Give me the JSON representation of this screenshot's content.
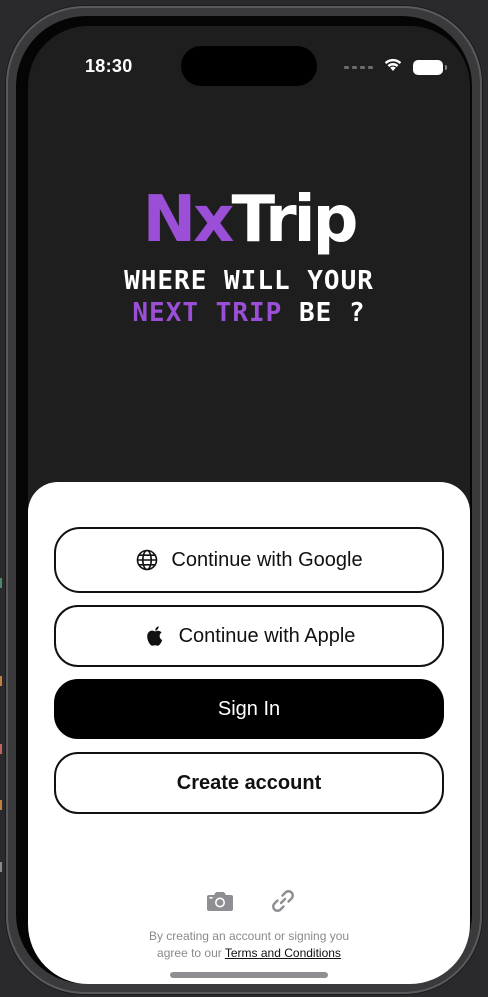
{
  "status_bar": {
    "time": "18:30"
  },
  "brand": {
    "logo_part1": "Nx",
    "logo_part2": "Trip"
  },
  "tagline": {
    "line1": "WHERE WILL YOUR",
    "line2_accent": "NEXT TRIP",
    "line2_rest": " BE ?"
  },
  "auth": {
    "google_label": "Continue with Google",
    "apple_label": "Continue with Apple",
    "signin_label": "Sign In",
    "create_label": "Create account"
  },
  "legal": {
    "line1": "By creating an account or signing you",
    "line2_prefix": "agree to our ",
    "terms_link": "Terms and Conditions"
  },
  "icons": [
    "globe-icon",
    "apple-icon",
    "camera-icon",
    "link-icon",
    "wifi-icon",
    "battery-icon"
  ],
  "colors": {
    "accent": "#9b4fd6",
    "screen_bg": "#1e1e1f",
    "sheet_bg": "#ffffff",
    "primary_button": "#000000"
  }
}
